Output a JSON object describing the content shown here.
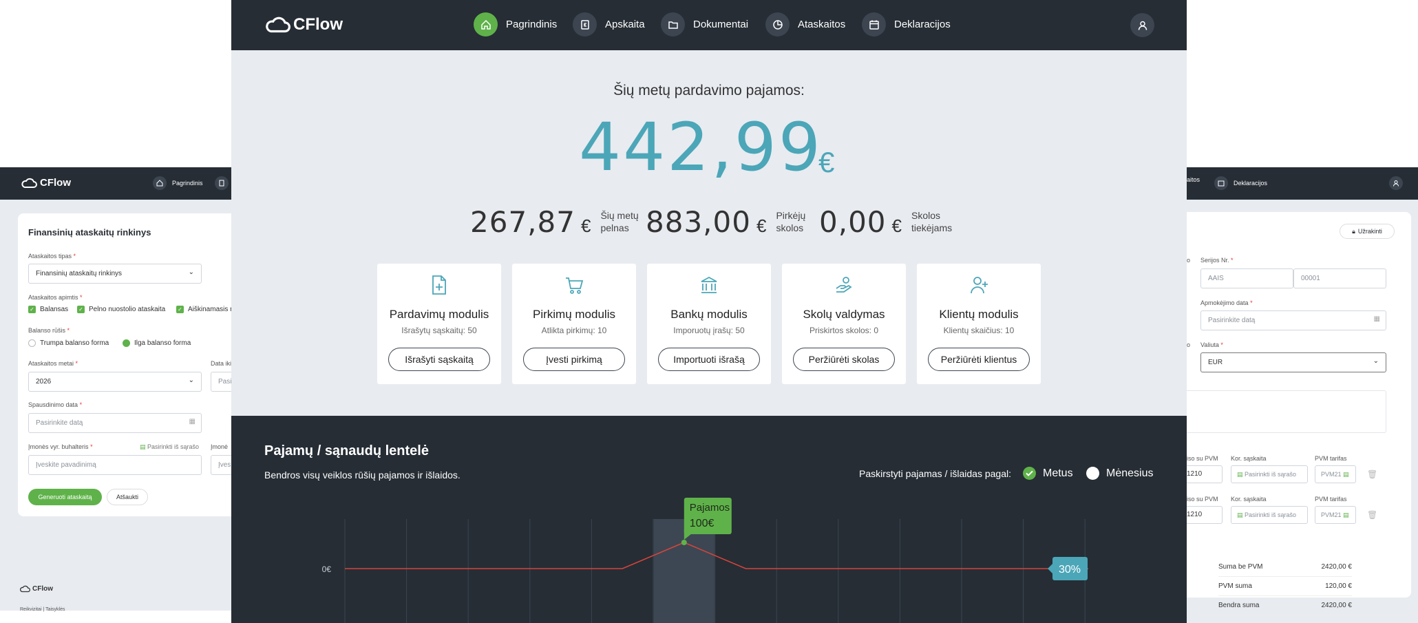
{
  "brand": {
    "name": "CFlow"
  },
  "nav": {
    "items": [
      {
        "label": "Pagrindinis",
        "icon": "home-icon",
        "active": true
      },
      {
        "label": "Apskaita",
        "icon": "euro-doc-icon"
      },
      {
        "label": "Dokumentai",
        "icon": "folder-icon"
      },
      {
        "label": "Ataskaitos",
        "icon": "pie-chart-icon"
      },
      {
        "label": "Deklaracijos",
        "icon": "calendar-icon"
      }
    ],
    "profile_icon": "user-icon"
  },
  "hero": {
    "title": "Šių metų pardavimo pajamos:",
    "value": "442,99",
    "currency": "€"
  },
  "stats": [
    {
      "value": "267,87",
      "currency": "€",
      "label_line1": "Šių metų",
      "label_line2": "pelnas"
    },
    {
      "value": "883,00",
      "currency": "€",
      "label_line1": "Pirkėjų",
      "label_line2": "skolos"
    },
    {
      "value": "0,00",
      "currency": "€",
      "label_line1": "Skolos",
      "label_line2": "tiekėjams"
    }
  ],
  "modules": [
    {
      "title": "Pardavimų modulis",
      "subtitle": "Išrašytų sąskaitų: 50",
      "button": "Išrašyti sąskaitą",
      "icon": "file-plus-icon"
    },
    {
      "title": "Pirkimų modulis",
      "subtitle": "Atlikta pirkimų: 10",
      "button": "Įvesti pirkimą",
      "icon": "cart-icon"
    },
    {
      "title": "Bankų modulis",
      "subtitle": "Imporuotų įrašų: 50",
      "button": "Importuoti išrašą",
      "icon": "bank-icon"
    },
    {
      "title": "Skolų valdymas",
      "subtitle": "Priskirtos skolos: 0",
      "button": "Peržiūrėti skolas",
      "icon": "hand-coins-icon"
    },
    {
      "title": "Klientų modulis",
      "subtitle": "Klientų skaičius: 10",
      "button": "Peržiūrėti klientus",
      "icon": "user-plus-icon"
    }
  ],
  "chart_section": {
    "title": "Pajamų / sąnaudų lentelė",
    "subtitle": "Bendros visų veiklos rūšių pajamos ir išlaidos.",
    "distribute_label": "Paskirstyti pajamas / išlaidas pagal:",
    "options": [
      {
        "label": "Metus",
        "selected": true
      },
      {
        "label": "Mėnesius",
        "selected": false
      }
    ]
  },
  "chart_data": {
    "type": "line",
    "ytick_labels": [
      "0€"
    ],
    "series": [
      {
        "values": [
          0,
          0,
          0,
          0,
          0,
          100,
          0,
          0,
          0,
          0,
          0,
          0
        ]
      }
    ],
    "tooltip": {
      "title": "Pajamos",
      "value": "100€"
    },
    "badge": "30%",
    "highlight_index": 5,
    "colors": {
      "line": "#d9443b",
      "point": "#5fb24a",
      "tooltip": "#5fb24a",
      "badge": "#4ba6b8"
    }
  },
  "bg_left": {
    "nav_items": [
      "Pagrindinis"
    ],
    "card_title": "Finansinių ataskaitų rinkinys",
    "type_label": "Ataskaitos tipas",
    "type_value": "Finansinių ataskaitų rinkinys",
    "scope_label": "Ataskaitos apimtis",
    "scope_items": [
      "Balansas",
      "Pelno nuostolio ataskaita",
      "Aiškinamasis r"
    ],
    "balance_label": "Balanso rūšis",
    "balance_options": [
      {
        "label": "Trumpa balanso forma",
        "selected": false
      },
      {
        "label": "Ilga balanso forma",
        "selected": true
      }
    ],
    "year_label": "Ataskaitos metai",
    "year_value": "2026",
    "date_to_label": "Data iki",
    "date_to_ph": "Pasi",
    "print_label": "Spausdinimo data",
    "print_ph": "Pasirinkite datą",
    "chief_label": "Įmonės vyr. buhalteris",
    "chief_pick": "Pasirinkti iš sąrašo",
    "chief_ph": "Įveskite pavadinimą",
    "company_label": "Įmonė",
    "company_ph": "Įves",
    "generate": "Generuoti ataskaitą",
    "cancel": "Atšaukti",
    "footer_links": [
      "Reikvizitai",
      "Taisyklės"
    ]
  },
  "bg_right": {
    "nav_items": [
      "aitos",
      "Deklaracijos"
    ],
    "lock": "Užrakinti",
    "series_label": "Serijos Nr.",
    "series_value": "AAIS",
    "number_value": "00001",
    "pay_label": "Apmokėjimo data",
    "pay_ph": "Pasirinkite datą",
    "currency_label": "Valiuta",
    "currency_value": "EUR",
    "rows": [
      {
        "pvm_label": "iso su PVM",
        "pvm_value": "1210",
        "acc_label": "Kor. sąskaita",
        "acc_ph": "Pasirinkti iš sąrašo",
        "tariff_label": "PVM tarifas",
        "tariff_value": "PVM21"
      },
      {
        "pvm_label": "iso su PVM",
        "pvm_value": "1210",
        "acc_label": "Kor. sąskaita",
        "acc_ph": "Pasirinkti iš sąrašo",
        "tariff_label": "PVM tarifas",
        "tariff_value": "PVM21"
      }
    ],
    "totals": [
      {
        "label": "Suma be PVM",
        "value": "2420,00 €"
      },
      {
        "label": "PVM suma",
        "value": "120,00 €"
      },
      {
        "label": "Bendra suma",
        "value": "2420,00 €"
      }
    ],
    "o_a": "o",
    "o_b": "o"
  }
}
